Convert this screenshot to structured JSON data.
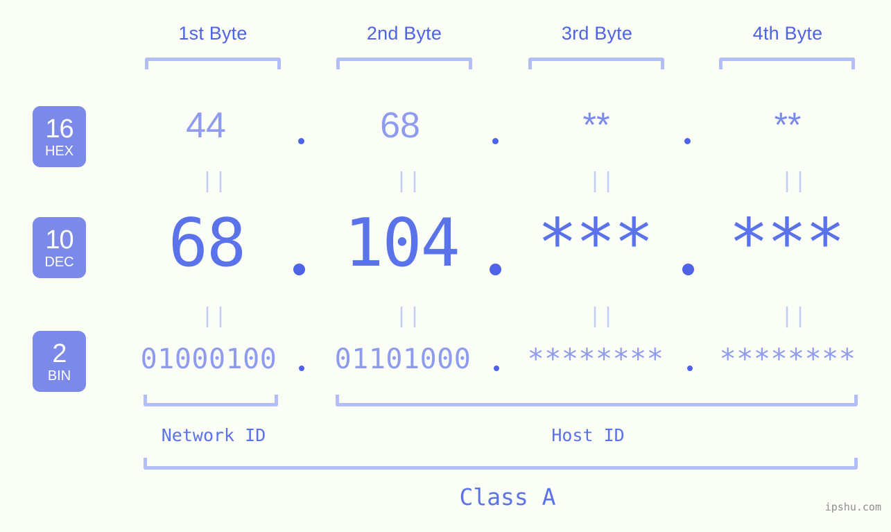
{
  "watermark": "ipshu.com",
  "byte_headers": [
    {
      "label": "1st Byte"
    },
    {
      "label": "2nd Byte"
    },
    {
      "label": "3rd Byte"
    },
    {
      "label": "4th Byte"
    }
  ],
  "bases": [
    {
      "num": "16",
      "name": "HEX"
    },
    {
      "num": "10",
      "name": "DEC"
    },
    {
      "num": "2",
      "name": "BIN"
    }
  ],
  "rows": {
    "hex": {
      "base_num": "16",
      "base_name": "HEX",
      "values": [
        "44",
        "68",
        "**",
        "**"
      ],
      "separator": "."
    },
    "dec": {
      "base_num": "10",
      "base_name": "DEC",
      "values": [
        "68",
        "104",
        "***",
        "***"
      ],
      "separator": "."
    },
    "bin": {
      "base_num": "2",
      "base_name": "BIN",
      "values": [
        "01000100",
        "01101000",
        "********",
        "********"
      ],
      "separator": "."
    }
  },
  "equals_symbol": "||",
  "segments": {
    "network_id": "Network ID",
    "host_id": "Host ID",
    "class": "Class A"
  },
  "colors": {
    "background": "#fbfdf7",
    "badge_bg": "#7b89e8",
    "badge_text": "#ffffff",
    "header_text": "#4f63e8",
    "bracket": "#b3bdf7",
    "value_strong": "#5a72ea",
    "value_light": "#8f9bee",
    "equals": "#c3cbf7",
    "watermark": "#8e8e8e"
  }
}
